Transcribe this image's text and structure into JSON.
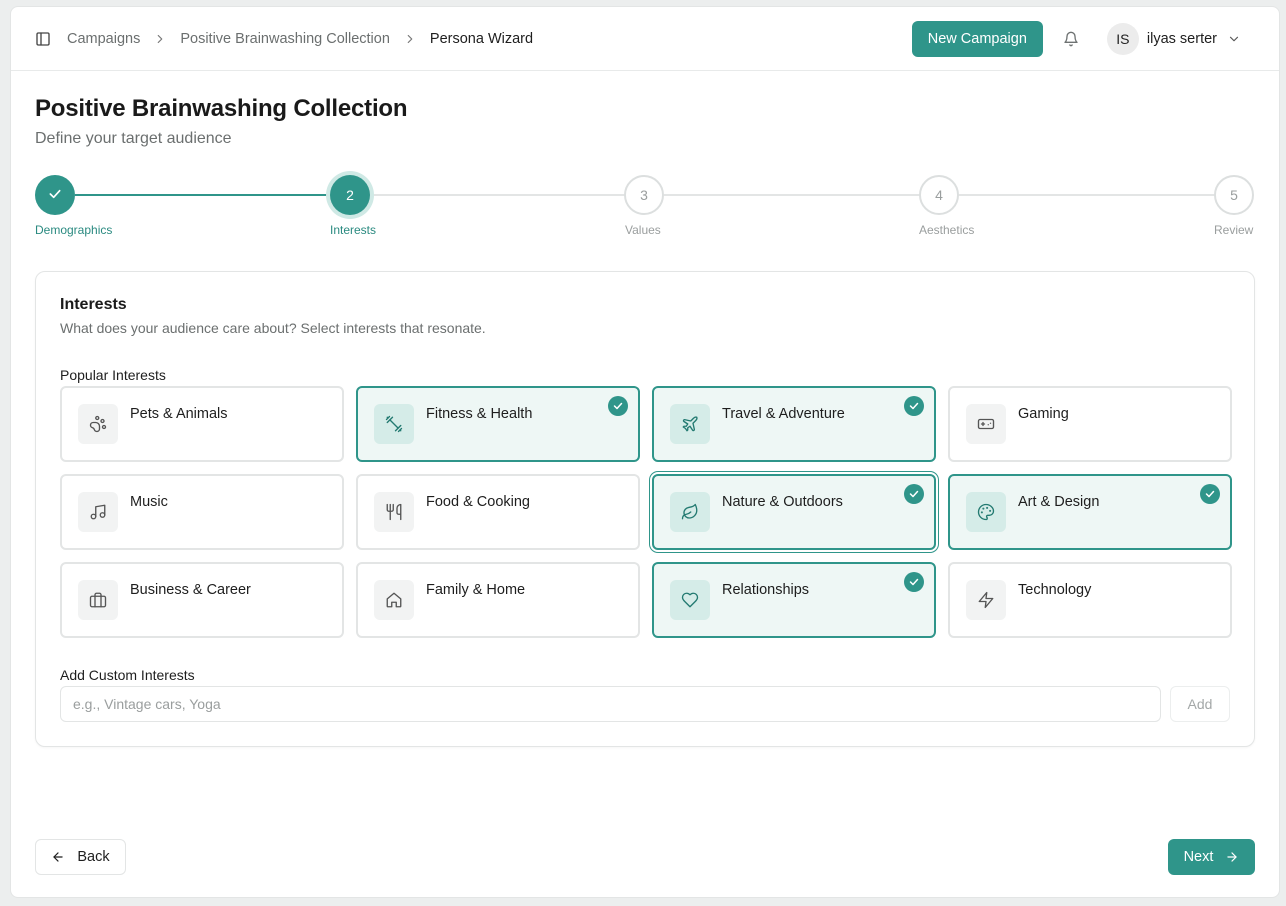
{
  "header": {
    "breadcrumbs": [
      "Campaigns",
      "Positive Brainwashing Collection",
      "Persona Wizard"
    ],
    "new_campaign_label": "New Campaign",
    "user": {
      "initials": "IS",
      "name": "ilyas serter"
    }
  },
  "page": {
    "title": "Positive Brainwashing Collection",
    "subtitle": "Define your target audience"
  },
  "stepper": {
    "current_step": 2,
    "steps": [
      {
        "number": "1",
        "label": "Demographics",
        "state": "done"
      },
      {
        "number": "2",
        "label": "Interests",
        "state": "active"
      },
      {
        "number": "3",
        "label": "Values",
        "state": "todo"
      },
      {
        "number": "4",
        "label": "Aesthetics",
        "state": "todo"
      },
      {
        "number": "5",
        "label": "Review",
        "state": "todo"
      }
    ]
  },
  "interests": {
    "title": "Interests",
    "description": "What does your audience care about? Select interests that resonate.",
    "popular_label": "Popular Interests",
    "items": [
      {
        "label": "Pets & Animals",
        "icon": "paw-icon",
        "selected": false
      },
      {
        "label": "Fitness & Health",
        "icon": "dumbbell-icon",
        "selected": true
      },
      {
        "label": "Travel & Adventure",
        "icon": "plane-icon",
        "selected": true
      },
      {
        "label": "Gaming",
        "icon": "gamepad-icon",
        "selected": false
      },
      {
        "label": "Music",
        "icon": "music-icon",
        "selected": false
      },
      {
        "label": "Food & Cooking",
        "icon": "utensils-icon",
        "selected": false
      },
      {
        "label": "Nature & Outdoors",
        "icon": "leaf-icon",
        "selected": true,
        "focused": true
      },
      {
        "label": "Art & Design",
        "icon": "palette-icon",
        "selected": true
      },
      {
        "label": "Business & Career",
        "icon": "briefcase-icon",
        "selected": false
      },
      {
        "label": "Family & Home",
        "icon": "home-icon",
        "selected": false
      },
      {
        "label": "Relationships",
        "icon": "heart-icon",
        "selected": true
      },
      {
        "label": "Technology",
        "icon": "zap-icon",
        "selected": false
      }
    ],
    "custom_label": "Add Custom Interests",
    "custom_placeholder": "e.g., Vintage cars, Yoga",
    "custom_value": "",
    "add_label": "Add"
  },
  "footer": {
    "back_label": "Back",
    "next_label": "Next"
  },
  "colors": {
    "accent": "#2f958a",
    "accent_light": "#eef7f5",
    "border": "#e3e5e5",
    "muted_text": "#6b6f6f"
  }
}
